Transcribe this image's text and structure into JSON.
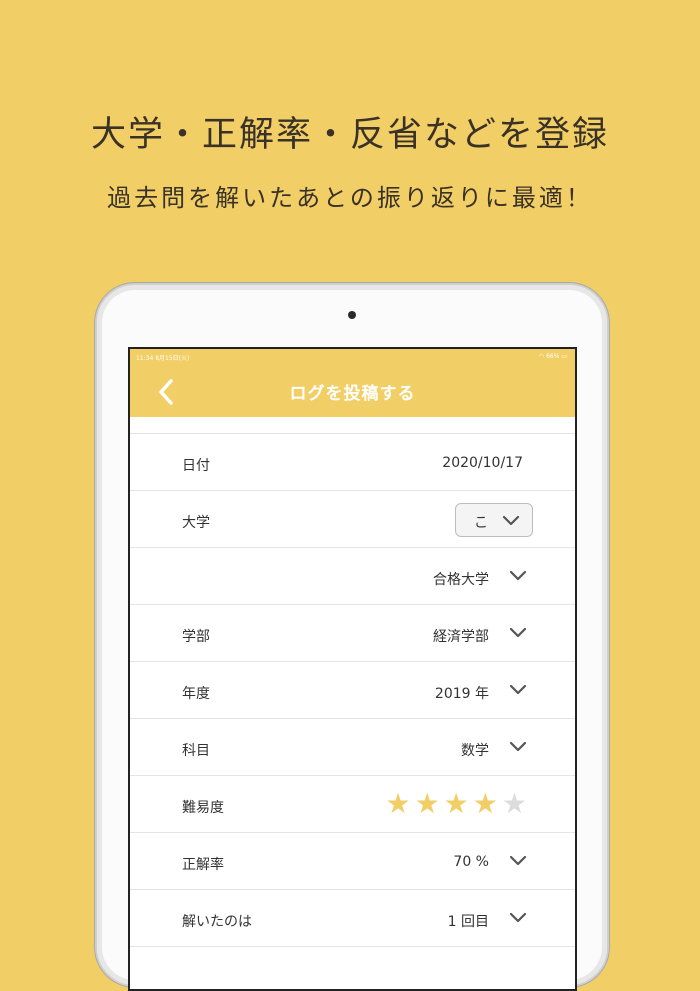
{
  "promo": {
    "headline": "大学・正解率・反省などを登録",
    "subline": "過去問を解いたあとの振り返りに最適！"
  },
  "status_bar": {
    "time": "11:34",
    "date": "8月15日(火)",
    "battery": "66%"
  },
  "nav": {
    "back_icon": "chevron-left-icon",
    "title": "ログを投稿する"
  },
  "form": {
    "date": {
      "label": "日付",
      "value": "2020/10/17"
    },
    "university": {
      "label": "大学",
      "picker_value": "こ"
    },
    "university_select": {
      "value": "合格大学"
    },
    "faculty": {
      "label": "学部",
      "value": "経済学部"
    },
    "year": {
      "label": "年度",
      "value": "2019 年"
    },
    "subject": {
      "label": "科目",
      "value": "数学"
    },
    "difficulty": {
      "label": "難易度",
      "rating": 4,
      "max": 5
    },
    "accuracy": {
      "label": "正解率",
      "value": "70 %"
    },
    "attempt": {
      "label": "解いたのは",
      "value": "1 回目"
    }
  },
  "colors": {
    "accent": "#f2cf66",
    "text": "#333333",
    "star_off": "#dcdcdc"
  }
}
